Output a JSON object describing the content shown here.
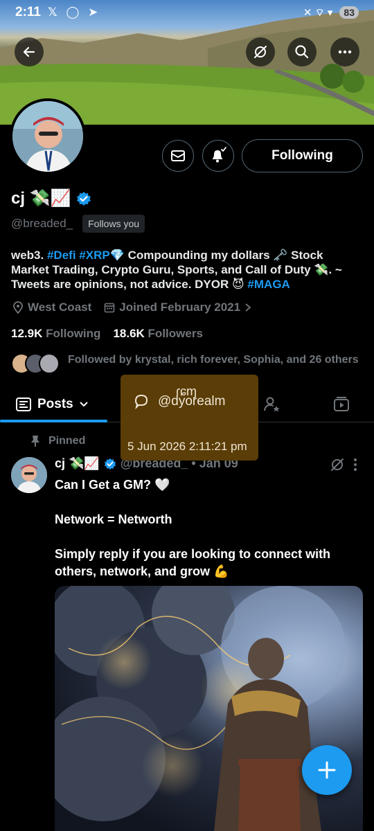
{
  "status_bar": {
    "time": "2:11",
    "left_icons": "𝕏 ◯ ➤",
    "right_icons": "✕ ⌔ ▾",
    "battery": "83"
  },
  "header": {
    "back_icon": "back-arrow-icon",
    "grok_icon": "grok-icon",
    "search_icon": "search-icon",
    "more_icon": "more-icon"
  },
  "profile": {
    "name": "cj 💸📈",
    "handle": "@breaded_",
    "follows_you": "Follows you",
    "following_button": "Following",
    "bio_parts": {
      "p1": "web3. ",
      "defi": "#Defi",
      "sp1": " ",
      "xrp": "#XRP",
      "p2": "💎 Compounding my dollars 🗝️ Stock Market Trading, Crypto Guru, Sports, and Call of Duty 💸. ~ Tweets are opinions, not advice. DYOR 😈 ",
      "maga": "#MAGA"
    },
    "location": "West Coast",
    "joined": "Joined February 2021",
    "following_count": "12.9K",
    "following_label": "Following",
    "followers_count": "18.6K",
    "followers_label": "Followers",
    "followed_by": "Followed by krystal, rich forever, Sophia, and 26 others"
  },
  "tabs": {
    "posts_label": "Posts"
  },
  "tooltip": {
    "name": "ɾɕɱ",
    "handle": "@dyorealm",
    "timestamp": "5 Jun 2026 2:11:21 pm"
  },
  "pinned_post": {
    "pinned_label": "Pinned",
    "name": "cj 💸📈",
    "handle_date": "@breaded_ • Jan 09",
    "line1": "Can I Get a GM? 🤍",
    "line2": "Network = Networth",
    "line3": "Simply reply if you are looking to connect with others, network, and grow 💪"
  },
  "colors": {
    "accent": "#1d9bf0",
    "tooltip_bg": "#5a3d07",
    "muted": "#71767b"
  }
}
